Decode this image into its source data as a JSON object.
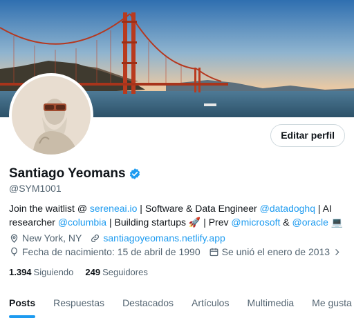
{
  "header": {
    "banner_image": "golden-gate-bridge-photo",
    "avatar_image": "classical-statue-portrait-with-vr-headset",
    "edit_button_label": "Editar perfil"
  },
  "profile": {
    "name": "Santiago Yeomans",
    "verified_icon": "verified-badge-icon",
    "handle": "@SYM1001",
    "bio": {
      "t1": "Join the waitlist @ ",
      "l1": "sereneai.io",
      "t2": " | Software & Data Engineer ",
      "l2": "@datadoghq",
      "t3": " | AI researcher ",
      "l3": "@columbia",
      "t4": " | Building startups 🚀 | Prev ",
      "l4": "@microsoft",
      "t5": " & ",
      "l5": "@oracle",
      "t6": " 💻"
    },
    "location": "New York, NY",
    "website": "santiagoyeomans.netlify.app",
    "birth": "Fecha de nacimiento: 15 de abril de 1990",
    "joined": "Se unió el enero de 2013",
    "following_count": "1.394",
    "following_label": "Siguiendo",
    "followers_count": "249",
    "followers_label": "Seguidores"
  },
  "tabs": [
    {
      "label": "Posts"
    },
    {
      "label": "Respuestas"
    },
    {
      "label": "Destacados"
    },
    {
      "label": "Artículos"
    },
    {
      "label": "Multimedia"
    },
    {
      "label": "Me gusta"
    }
  ],
  "colors": {
    "accent": "#1d9bf0",
    "secondary_text": "#536471",
    "primary_text": "#0f1419"
  }
}
